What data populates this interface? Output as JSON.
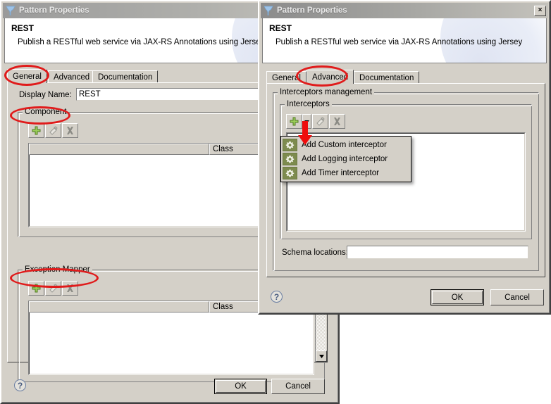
{
  "background_dialog": {
    "title": "Pattern Properties",
    "title_icon": "app-logo-icon",
    "header": {
      "title": "REST",
      "subtitle": "Publish a RESTful web service via JAX-RS Annotations using Jersey"
    },
    "tabs": [
      {
        "label": "General",
        "selected": true
      },
      {
        "label": "Advanced",
        "selected": false
      },
      {
        "label": "Documentation",
        "selected": false
      }
    ],
    "fields": {
      "display_name_label": "Display Name:",
      "display_name_value": "REST",
      "display_name_placeholder": ""
    },
    "groups": [
      {
        "label": "Component",
        "toolbar": [
          {
            "icon": "add-plus-icon",
            "enabled": true
          },
          {
            "icon": "edit-pencil-icon",
            "enabled": false
          },
          {
            "icon": "delete-x-icon",
            "enabled": false
          }
        ],
        "columns": [
          "",
          "Class"
        ],
        "rows": []
      },
      {
        "label": "Exception Mapper",
        "toolbar": [
          {
            "icon": "add-plus-icon",
            "enabled": true
          },
          {
            "icon": "edit-pencil-icon",
            "enabled": false
          },
          {
            "icon": "delete-x-icon",
            "enabled": false
          }
        ],
        "columns": [
          "",
          "Class"
        ],
        "rows": []
      }
    ],
    "footer": {
      "help_label": "?",
      "ok_label": "OK",
      "cancel_label": "Cancel"
    },
    "scrollbar": {
      "down_arrow_icon": "chevron-down-icon"
    }
  },
  "foreground_dialog": {
    "title": "Pattern Properties",
    "title_icon": "app-logo-icon",
    "close_label": "×",
    "header": {
      "title": "REST",
      "subtitle": "Publish a RESTful web service via JAX-RS Annotations using Jersey"
    },
    "tabs": [
      {
        "label": "General",
        "selected": false
      },
      {
        "label": "Advanced",
        "selected": true
      },
      {
        "label": "Documentation",
        "selected": false
      }
    ],
    "groups": {
      "outer_label": "Interceptors management",
      "inner_label": "Interceptors"
    },
    "toolbar": [
      {
        "icon": "add-plus-icon",
        "enabled": true
      },
      {
        "icon": "chevron-down-icon",
        "enabled": true
      },
      {
        "icon": "edit-pencil-icon",
        "enabled": false
      },
      {
        "icon": "delete-x-icon",
        "enabled": false
      }
    ],
    "dropdown_menu": {
      "open": true,
      "items": [
        {
          "icon": "gear-icon",
          "label": "Add Custom interceptor"
        },
        {
          "icon": "gear-icon",
          "label": "Add Logging interceptor"
        },
        {
          "icon": "gear-icon",
          "label": "Add Timer interceptor"
        }
      ]
    },
    "schema": {
      "label": "Schema locations:",
      "value": "",
      "placeholder": ""
    },
    "footer": {
      "help_label": "?",
      "ok_label": "OK",
      "cancel_label": "Cancel"
    }
  },
  "annotations": {
    "color": "#e01b1b",
    "ellipses": [
      {
        "target": "background-tab-general"
      },
      {
        "target": "background-group-component"
      },
      {
        "target": "background-group-exception-mapper"
      },
      {
        "target": "foreground-tab-advanced"
      }
    ],
    "arrow": {
      "target": "foreground-add-dropdown",
      "direction": "down"
    }
  }
}
